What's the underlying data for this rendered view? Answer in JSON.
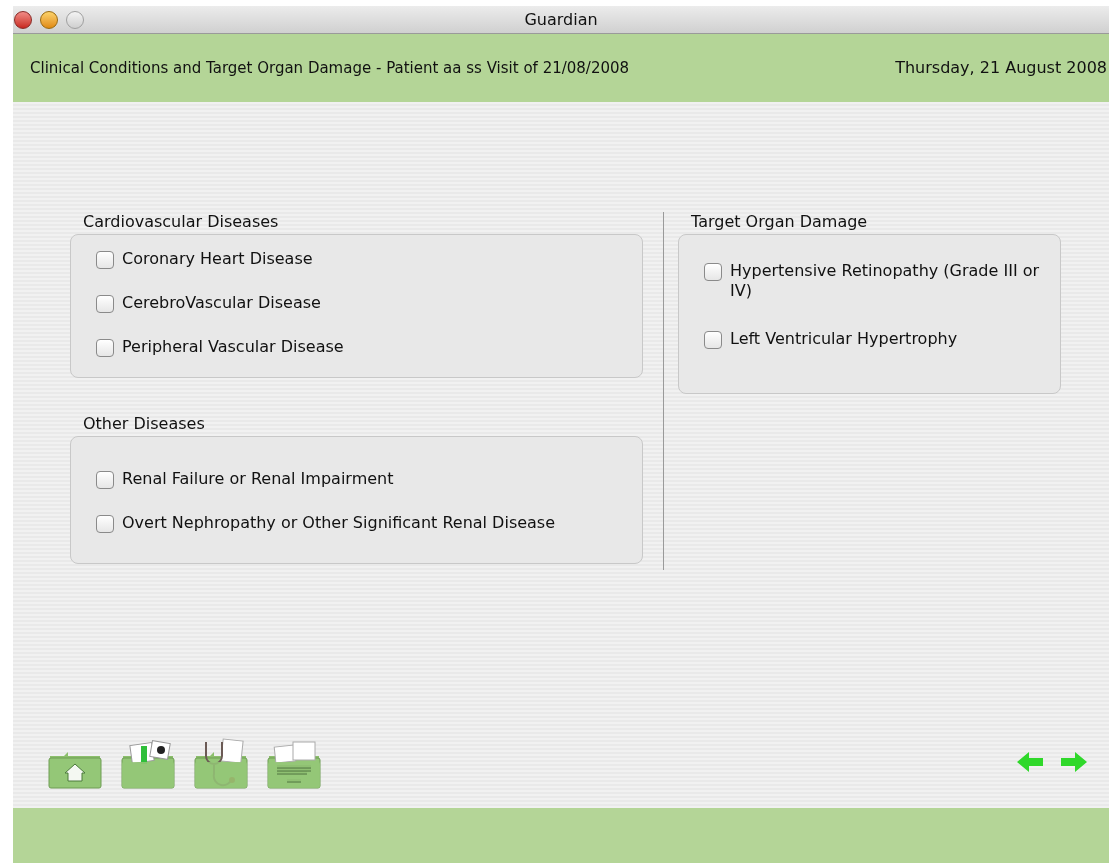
{
  "window": {
    "title": "Guardian"
  },
  "header": {
    "title": "Clinical Conditions and Target Organ Damage - Patient aa ss Visit of 21/08/2008",
    "date": "Thursday, 21 August 2008"
  },
  "left_groups": [
    {
      "title": "Cardiovascular Diseases",
      "items": [
        {
          "label": "Coronary Heart Disease",
          "checked": false
        },
        {
          "label": "CerebroVascular Disease",
          "checked": false
        },
        {
          "label": "Peripheral Vascular Disease",
          "checked": false
        }
      ]
    },
    {
      "title": "Other Diseases",
      "items": [
        {
          "label": "Renal Failure or Renal Impairment",
          "checked": false
        },
        {
          "label": "Overt Nephropathy or Other Significant Renal Disease",
          "checked": false
        }
      ]
    }
  ],
  "right_groups": [
    {
      "title": "Target Organ Damage",
      "items": [
        {
          "label": "Hypertensive Retinopathy (Grade III or IV)",
          "checked": false
        },
        {
          "label": "Left Ventricular Hypertrophy",
          "checked": false
        }
      ]
    }
  ],
  "toolbar": [
    {
      "kind": "home"
    },
    {
      "kind": "records"
    },
    {
      "kind": "stethoscope"
    },
    {
      "kind": "documents"
    }
  ]
}
